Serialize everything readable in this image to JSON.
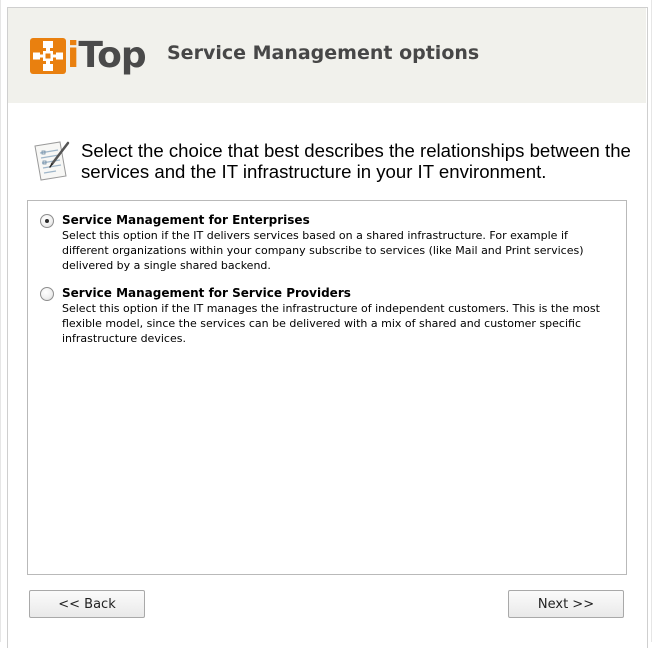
{
  "header": {
    "logo_text_i": "i",
    "logo_text_rest": "Top",
    "title": "Service Management options"
  },
  "question": {
    "icon": "form-edit-icon",
    "text": "Select the choice that best describes the relationships between the services and the IT infrastructure in your IT environment."
  },
  "options": [
    {
      "label": "Service Management for Enterprises",
      "description": "Select this option if the IT delivers services based on a shared infrastructure. For example if different organizations within your company subscribe to services (like Mail and Print services) delivered by a single shared backend.",
      "selected": true
    },
    {
      "label": "Service Management for Service Providers",
      "description": "Select this option if the IT manages the infrastructure of independent customers. This is the most flexible model, since the services can be delivered with a mix of shared and customer specific infrastructure devices.",
      "selected": false
    }
  ],
  "buttons": {
    "back": "<< Back",
    "next": "Next >>"
  },
  "colors": {
    "header_bg": "#f1f1ec",
    "logo_orange": "#e9800f",
    "title_gray": "#474747"
  }
}
